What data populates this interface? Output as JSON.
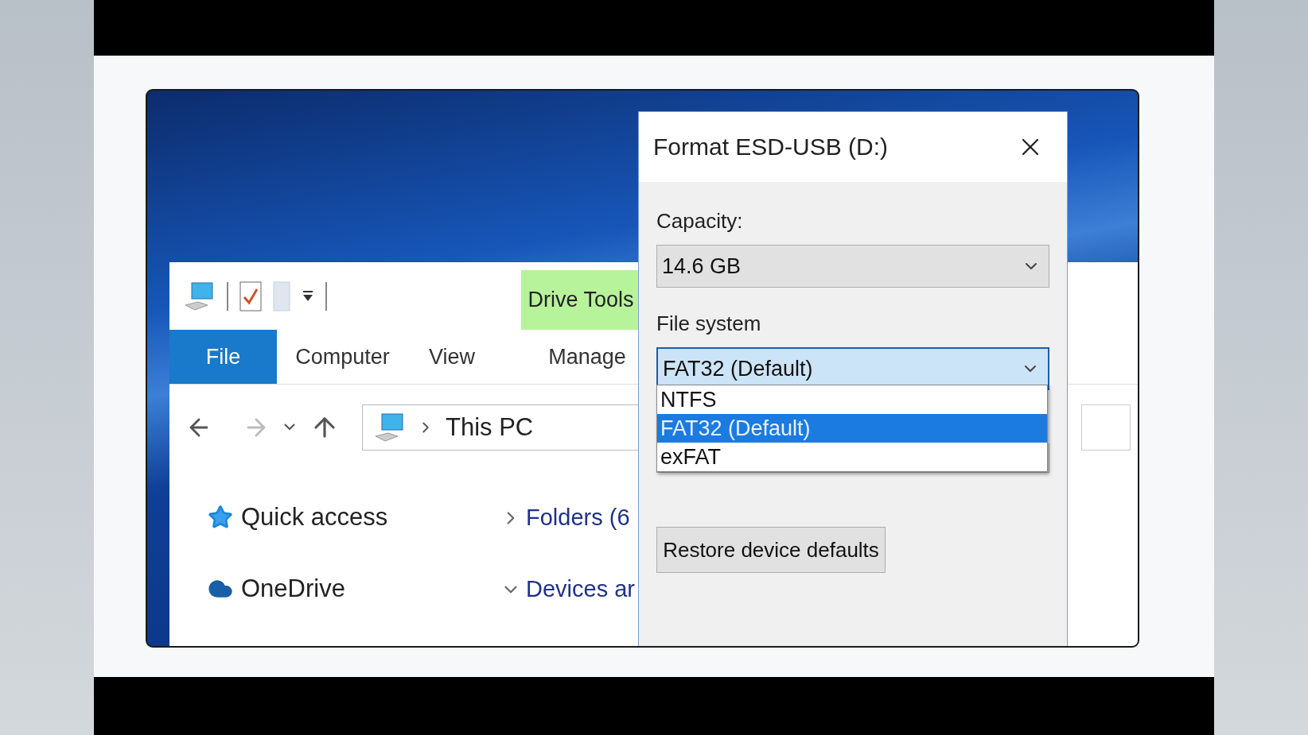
{
  "explorer": {
    "contextual_tab": "Drive Tools",
    "ribbon_tabs": [
      {
        "label": "File",
        "selected": true
      },
      {
        "label": "Computer",
        "selected": false
      },
      {
        "label": "View",
        "selected": false
      },
      {
        "label": "Manage",
        "selected": false
      }
    ],
    "address": {
      "path": "This PC"
    },
    "nav_pane": [
      {
        "label": "Quick access",
        "kind": "star"
      },
      {
        "label": "OneDrive",
        "kind": "cloud"
      }
    ],
    "groups": [
      {
        "label": "Folders (6",
        "expanded": false
      },
      {
        "label": "Devices ar",
        "expanded": true
      }
    ]
  },
  "dialog": {
    "title": "Format ESD-USB (D:)",
    "capacity": {
      "label": "Capacity:",
      "value": "14.6 GB"
    },
    "file_system": {
      "label": "File system",
      "value": "FAT32 (Default)",
      "expanded": true,
      "options": [
        {
          "label": "NTFS",
          "selected": false
        },
        {
          "label": "FAT32 (Default)",
          "selected": true
        },
        {
          "label": "exFAT",
          "selected": false
        }
      ]
    },
    "buttons": [
      "Restore device defaults"
    ]
  }
}
